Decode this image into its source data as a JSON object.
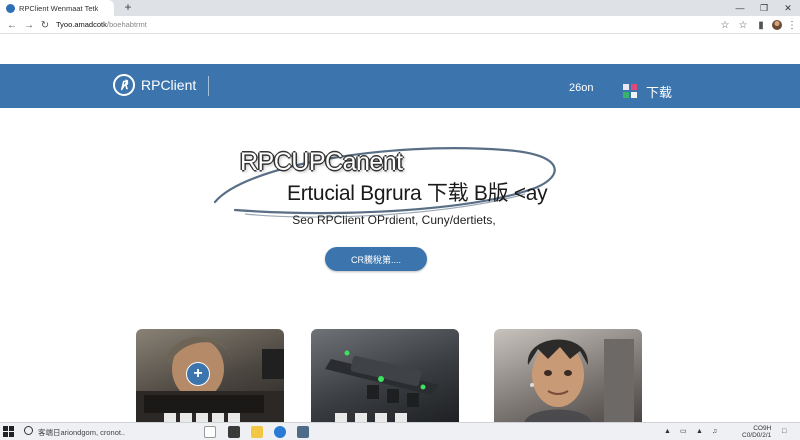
{
  "browser": {
    "tab_title": "RPClient Wenmaat Tetk",
    "address_host": "Tyoo.amadcotk",
    "address_path": "/boehabtrmt",
    "new_tab_symbol": "+"
  },
  "header": {
    "brand": "RPClient",
    "logo_symbol": "℟",
    "version": "26on",
    "download_label": "下载"
  },
  "hero": {
    "title": "RPCUPCanent",
    "subtitle": "Ertucial Bgrura 下载 B版 <ay",
    "tagline": "Seo RPClient OPrdient, Cuny/dertiets,",
    "cta_label": "CR騰稅第...."
  },
  "cards": {
    "plus_symbol": "+"
  },
  "taskbar": {
    "search_placeholder": "客端日ariondgom, cronot..",
    "clock_time": "CO9H",
    "clock_date": "C0/D0/2/1"
  },
  "colors": {
    "brand_blue": "#3c74ad"
  }
}
